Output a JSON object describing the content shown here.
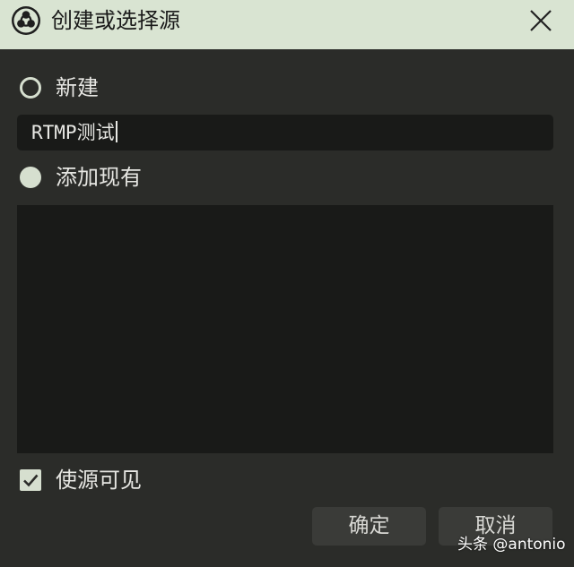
{
  "window": {
    "title": "创建或选择源",
    "close_icon": "close-icon",
    "app_icon": "obs-logo-icon"
  },
  "options": {
    "new_label": "新建",
    "new_selected": false,
    "new_name_value": "RTMP测试",
    "existing_label": "添加现有",
    "existing_selected": true,
    "existing_items": []
  },
  "visibility": {
    "label": "使源可见",
    "checked": true
  },
  "buttons": {
    "ok_label": "确定",
    "cancel_label": "取消"
  },
  "watermark": "头条 @antonio",
  "colors": {
    "titlebar": "#d9e4d2",
    "background": "#2b2c29",
    "field": "#191a18",
    "button": "#3a3b38",
    "accent": "#d6dfcf"
  }
}
